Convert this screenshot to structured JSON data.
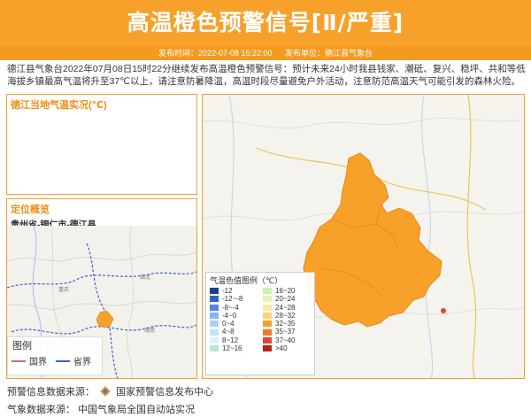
{
  "header": {
    "title": "高温橙色预警信号[Ⅱ/严重]",
    "publish_time": "发布时间：2022-07-08 15:22:00",
    "publisher": "发布单位：德江县气象台"
  },
  "description": "德江县气象台2022年07月08日15时22分继续发布高温橙色预警信号：预计未来24小时我县钱家、潮砥、复兴、稳坪、共和等低海拔乡镇最高气温将升至37℃以上，请注意防暑降温，高温时段尽量避免户外活动，注意防范高温天气可能引发的森林火险。",
  "temp_panel": {
    "title": "德江当地气温实况(℃)"
  },
  "location_panel": {
    "title": "定位概览",
    "region": "贵州省-铜仁市-德江县",
    "legend": {
      "title": "图例",
      "national_border": "国界",
      "provincial_border": "省界"
    },
    "colors": {
      "national": "#c8706a",
      "provincial": "#3b63c8",
      "county_highlight": "#f7a12b"
    }
  },
  "color_legend": {
    "title": "气温色值图例（℃）",
    "items": [
      {
        "label": "-12",
        "color": "#1f3f8f"
      },
      {
        "label": "16~20",
        "color": "#c9efb7"
      },
      {
        "label": "-12~-8",
        "color": "#2d63c9"
      },
      {
        "label": "20~24",
        "color": "#e9f0a6"
      },
      {
        "label": "-8~-4",
        "color": "#4c87e2"
      },
      {
        "label": "24~28",
        "color": "#fde6a1"
      },
      {
        "label": "-4~0",
        "color": "#86b6f0"
      },
      {
        "label": "28~32",
        "color": "#fcd27a"
      },
      {
        "label": "0~4",
        "color": "#a9d0f7"
      },
      {
        "label": "32~35",
        "color": "#f7a12b"
      },
      {
        "label": "4~8",
        "color": "#c5e3fb"
      },
      {
        "label": "35~37",
        "color": "#f07c2b"
      },
      {
        "label": "8~12",
        "color": "#dff0fc"
      },
      {
        "label": "37~40",
        "color": "#e0482b"
      },
      {
        "label": "12~16",
        "color": "#b6e7d8"
      },
      {
        "label": ">40",
        "color": "#b41f1f"
      }
    ]
  },
  "map": {
    "county_color": "#f7a12b"
  },
  "footer": {
    "warning_source_label": "预警信息数据来源：",
    "warning_source": "国家预警信息发布中心",
    "weather_source_label": "气象数据来源：",
    "weather_source": "中国气象局全国自动站实况"
  }
}
